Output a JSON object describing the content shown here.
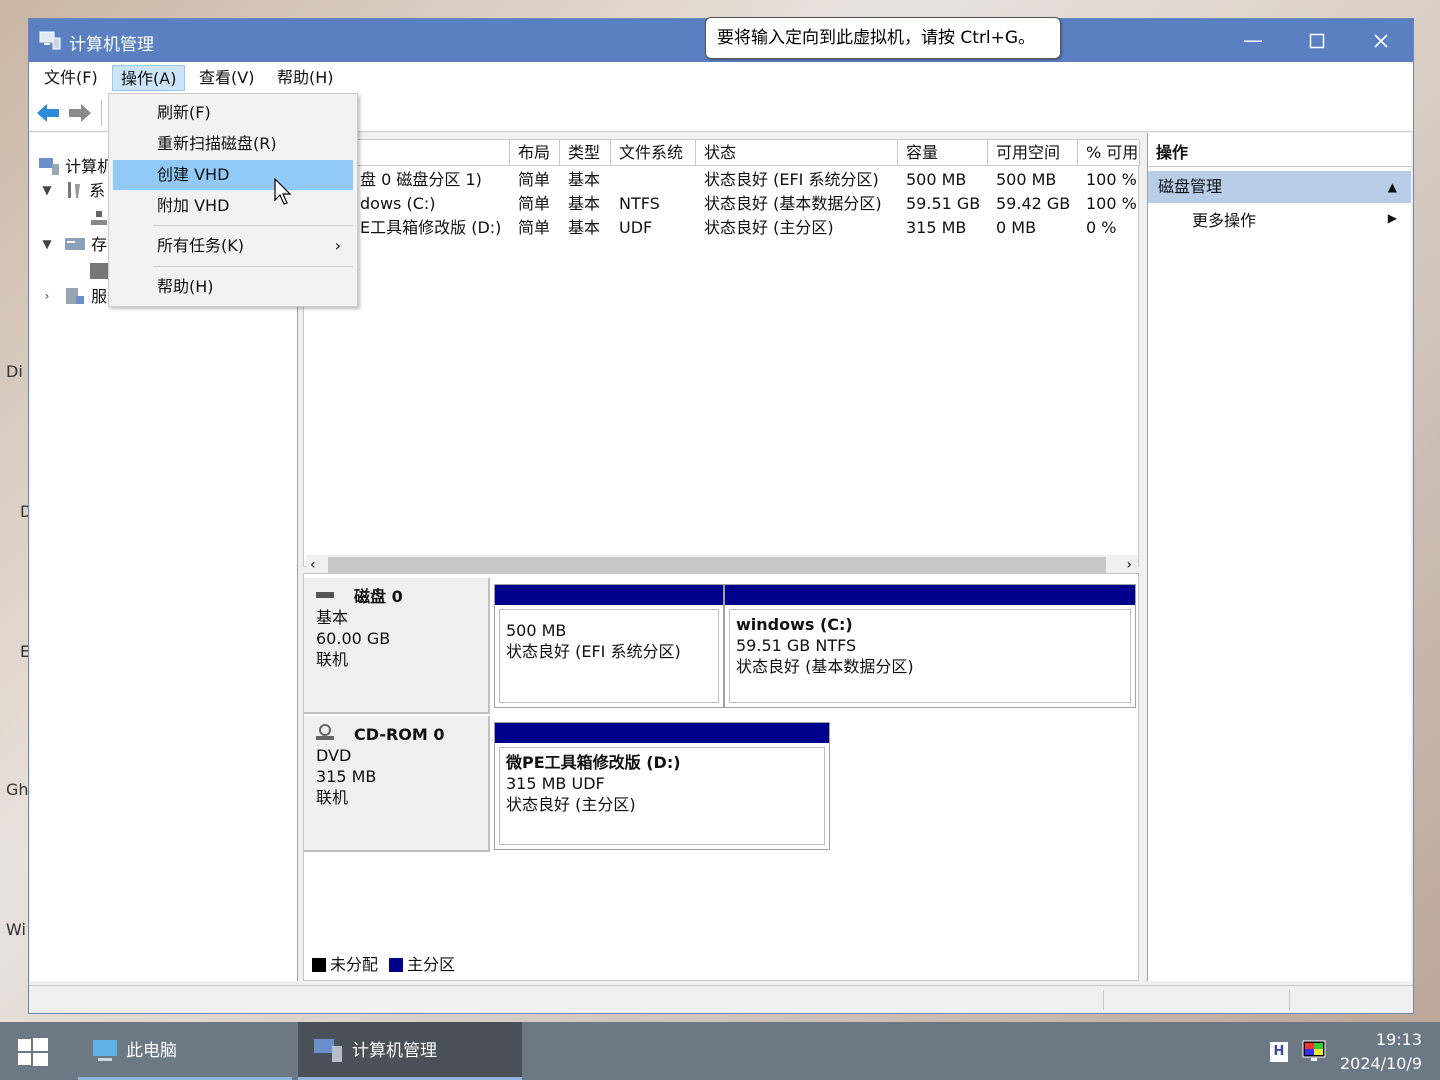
{
  "window": {
    "title": "计算机管理"
  },
  "tooltip": {
    "text": "要将输入定向到此虚拟机，请按 Ctrl+G。"
  },
  "menubar": {
    "items": [
      "文件(F)",
      "操作(A)",
      "查看(V)",
      "帮助(H)"
    ]
  },
  "dropdown": {
    "items": [
      {
        "label": "刷新(F)"
      },
      {
        "label": "重新扫描磁盘(R)"
      },
      {
        "label": "创建 VHD"
      },
      {
        "label": "附加 VHD"
      },
      {
        "label": "所有任务(K)",
        "submenu": "›"
      },
      {
        "label": "帮助(H)"
      }
    ]
  },
  "tree": {
    "root": "计算机",
    "system": "系",
    "storage": "存",
    "services": "服"
  },
  "volume_table": {
    "columns": [
      "布局",
      "类型",
      "文件系统",
      "状态",
      "容量",
      "可用空间",
      "% 可用"
    ],
    "rows": [
      {
        "name": "盘 0 磁盘分区 1)",
        "layout": "简单",
        "type": "基本",
        "fs": "",
        "status": "状态良好 (EFI 系统分区)",
        "capacity": "500 MB",
        "free": "500 MB",
        "pct": "100 %"
      },
      {
        "name": "dows (C:)",
        "layout": "简单",
        "type": "基本",
        "fs": "NTFS",
        "status": "状态良好 (基本数据分区)",
        "capacity": "59.51 GB",
        "free": "59.42 GB",
        "pct": "100 %"
      },
      {
        "name": "E工具箱修改版 (D:)",
        "layout": "简单",
        "type": "基本",
        "fs": "UDF",
        "status": "状态良好 (主分区)",
        "capacity": "315 MB",
        "free": "0 MB",
        "pct": "0 %"
      }
    ]
  },
  "disks": [
    {
      "name": "磁盘 0",
      "type": "基本",
      "size": "60.00 GB",
      "state": "联机",
      "partitions": [
        {
          "title": "",
          "line1": "500 MB",
          "line2": "状态良好 (EFI 系统分区)"
        },
        {
          "title": "windows  (C:)",
          "line1": "59.51 GB NTFS",
          "line2": "状态良好 (基本数据分区)"
        }
      ]
    },
    {
      "name": "CD-ROM 0",
      "type": "DVD",
      "size": "315 MB",
      "state": "联机",
      "partitions": [
        {
          "title": "微PE工具箱修改版  (D:)",
          "line1": "315 MB UDF",
          "line2": "状态良好 (主分区)"
        }
      ]
    }
  ],
  "legend": {
    "unallocated": "未分配",
    "primary": "主分区",
    "unallocated_color": "#000000",
    "primary_color": "#00008b"
  },
  "actions": {
    "header": "操作",
    "section": "磁盘管理",
    "more": "更多操作"
  },
  "taskbar": {
    "items": [
      "此电脑",
      "计算机管理"
    ],
    "time": "19:13",
    "date": "2024/10/9",
    "ime": "H"
  },
  "desktop": {
    "labels": [
      "Di",
      "D",
      "E",
      "Gh",
      "Wi"
    ]
  },
  "colors": {
    "titlebar": "#5a80c2",
    "highlight": "#91c9f7",
    "partition_bar": "#00008b",
    "taskbar": "#6d7885"
  }
}
